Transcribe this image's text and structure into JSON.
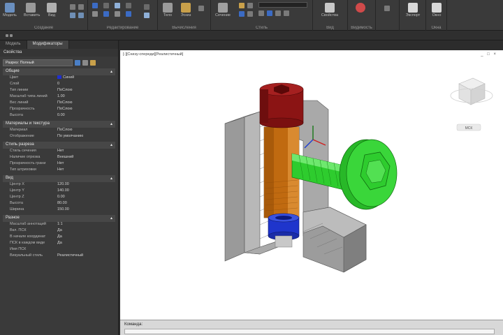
{
  "ribbon": {
    "groups": [
      {
        "label": "Создание"
      },
      {
        "label": "Редактирование"
      },
      {
        "label": "Вычисления"
      },
      {
        "label": "Стиль"
      },
      {
        "label": "Вид"
      },
      {
        "label": "Видимость"
      },
      {
        "label": "Окна"
      }
    ],
    "buttons": [
      {
        "label": "Модель"
      },
      {
        "label": "Вставить"
      },
      {
        "label": "Вид"
      },
      {
        "label": "Тело"
      },
      {
        "label": "Эскиз"
      },
      {
        "label": "Сечение"
      },
      {
        "label": "Свойства"
      },
      {
        "label": "Экспорт"
      },
      {
        "label": "Окно"
      }
    ]
  },
  "panel": {
    "tabs": [
      "Модель",
      "Модификаторы"
    ],
    "title": "Свойства",
    "selector": "Разрез: Полный",
    "sections": [
      {
        "title": "Общие",
        "rows": [
          {
            "k": "Цвет",
            "v": "Синий",
            "swatch": true
          },
          {
            "k": "Слой",
            "v": "0"
          },
          {
            "k": "Тип линии",
            "v": "ПоСлою"
          },
          {
            "k": "Масштаб типа линий",
            "v": "1.00"
          },
          {
            "k": "Вес линий",
            "v": "ПоСлою"
          },
          {
            "k": "Прозрачность",
            "v": "ПоСлою"
          },
          {
            "k": "Высота",
            "v": "0.00"
          }
        ]
      },
      {
        "title": "Материалы и текстура",
        "rows": [
          {
            "k": "Материал",
            "v": "ПоСлою"
          },
          {
            "k": "Отображение",
            "v": "По умолчанию"
          }
        ]
      },
      {
        "title": "Стиль разреза",
        "rows": [
          {
            "k": "Стиль сечения",
            "v": "Нет"
          },
          {
            "k": "Наличие отрезка",
            "v": "Внешний"
          },
          {
            "k": "Прозрачность грани",
            "v": "Нет"
          },
          {
            "k": "Тип штриховки",
            "v": "Нет"
          }
        ]
      },
      {
        "title": "Вид",
        "rows": [
          {
            "k": "Центр X",
            "v": "120.00"
          },
          {
            "k": "Центр Y",
            "v": "140.00"
          },
          {
            "k": "Центр Z",
            "v": "0.00"
          },
          {
            "k": "Высота",
            "v": "80.00"
          },
          {
            "k": "Ширина",
            "v": "150.00"
          }
        ]
      },
      {
        "title": "Разное",
        "rows": [
          {
            "k": "Масштаб аннотаций",
            "v": "1:1"
          },
          {
            "k": "Вкл. ПСК",
            "v": "Да"
          },
          {
            "k": "В начале координат",
            "v": "Да"
          },
          {
            "k": "ПСК в каждом виде",
            "v": "Да"
          },
          {
            "k": "Имя ПСК",
            "v": ""
          },
          {
            "k": "Визуальный стиль",
            "v": "Реалистичный"
          }
        ]
      }
    ]
  },
  "viewport": {
    "title": "[-][Снизу-спереди][Реалистичный]",
    "wcs": "МСК",
    "window_buttons": "_ □ ×"
  },
  "cmdline": {
    "label": "Команда:"
  },
  "colors": {
    "head": "#8b1414",
    "body": "#c06a10",
    "ring": "#1f35cc",
    "green": "#2ecc2e",
    "grey": "#8c8c8c"
  }
}
